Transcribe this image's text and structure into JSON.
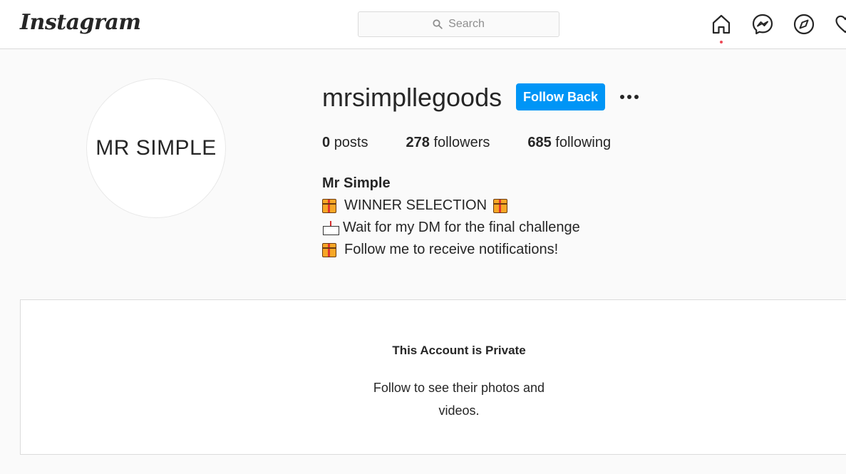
{
  "nav": {
    "logo": "Instagram",
    "search_placeholder": "Search",
    "icons": [
      "home-icon",
      "messenger-icon",
      "explore-icon",
      "heart-icon"
    ],
    "accent_dot_color": "#ed4956"
  },
  "profile": {
    "avatar_text": "MR SIMPLE",
    "username": "mrsimpllegoods",
    "follow_button": "Follow Back",
    "stats": {
      "posts_count": "0",
      "posts_label": "posts",
      "followers_count": "278",
      "followers_label": "followers",
      "following_count": "685",
      "following_label": "following"
    },
    "bio": {
      "name": "Mr Simple",
      "line1": "WINNER SELECTION",
      "line2": "Wait for my DM for the final challenge",
      "line3": "Follow me to receive notifications!"
    }
  },
  "private": {
    "title": "This Account is Private",
    "description": "Follow to see their photos and videos."
  },
  "colors": {
    "button_blue": "#0095f6",
    "border": "#dbdbdb",
    "background": "#fafafa"
  }
}
